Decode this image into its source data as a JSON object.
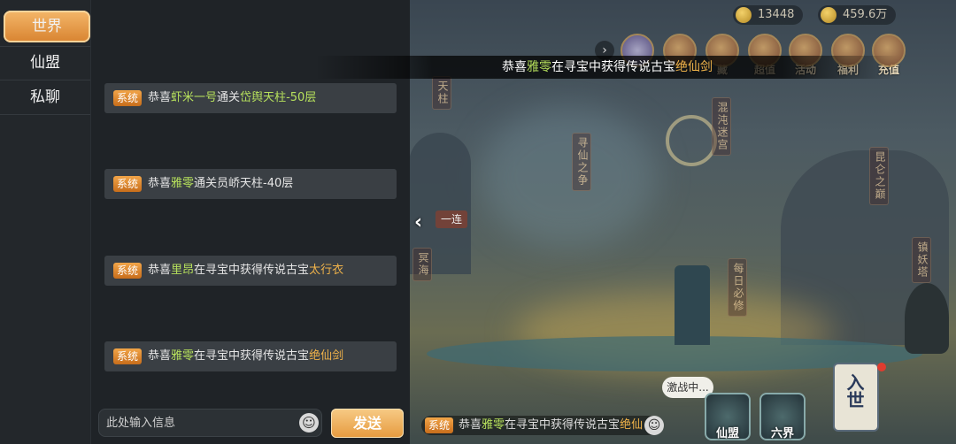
{
  "sidebar": {
    "tabs": [
      {
        "label": "世界",
        "active": true
      },
      {
        "label": "仙盟",
        "active": false
      },
      {
        "label": "私聊",
        "active": false
      }
    ]
  },
  "chat": {
    "messages": [
      {
        "tag": "系统",
        "prefix": "恭喜",
        "name": "虾米一号",
        "mid": "通关",
        "item": "岱舆天柱-50层",
        "suffix": ""
      },
      {
        "tag": "系统",
        "prefix": "恭喜",
        "name": "雅零",
        "mid": "通关员峤天柱-40层",
        "item": "",
        "suffix": ""
      },
      {
        "tag": "系统",
        "prefix": "恭喜",
        "name": "里昂",
        "mid": "在寻宝中获得传说古宝",
        "item": "太行衣",
        "suffix": ""
      },
      {
        "tag": "系统",
        "prefix": "恭喜",
        "name": "雅零",
        "mid": "在寻宝中获得传说古宝",
        "item": "绝仙剑",
        "suffix": ""
      }
    ],
    "input_placeholder": "此处输入信息",
    "send_label": "发送",
    "emoji_glyph": "☺"
  },
  "banner": {
    "prefix": "恭喜",
    "name": "雅零",
    "mid": "在寻宝中获得传说古宝",
    "item": "绝仙剑"
  },
  "scene": {
    "resources": [
      {
        "name": "ingot",
        "value": "13448"
      },
      {
        "name": "gold-coin",
        "value": "459.6万"
      }
    ],
    "top_buttons": [
      {
        "label": "藏"
      },
      {
        "label": "超值"
      },
      {
        "label": "活动"
      },
      {
        "label": "福利"
      },
      {
        "label": "充值"
      }
    ],
    "signs": [
      "天柱",
      "寻仙之争",
      "混沌迷宫",
      "昆仑之巅",
      "每日必修",
      "冥海",
      "镇妖塔"
    ],
    "bubble": "激战中...",
    "bottom_buttons": [
      {
        "label": "仙盟"
      },
      {
        "label": "六界"
      }
    ],
    "scroll_label": "入世",
    "ticker": {
      "tag": "系统",
      "prefix": "恭喜",
      "name": "雅零",
      "mid": "在寻宝中获得传说古宝",
      "item": "绝仙"
    },
    "link_label": "一连"
  },
  "colors": {
    "accent": "#e69a3e",
    "name_highlight": "#b6e05c",
    "item_highlight": "#f0b34a"
  }
}
